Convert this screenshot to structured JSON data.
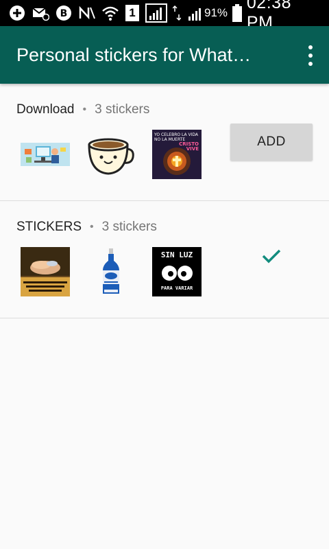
{
  "status_bar": {
    "sim_slot": "1",
    "battery": "91%",
    "time": "02:38 PM"
  },
  "app_bar": {
    "title": "Personal stickers for What…"
  },
  "packs": [
    {
      "name": "Download",
      "separator": "•",
      "count": "3 stickers",
      "action_label": "ADD",
      "thumb_texts": [
        "YO CELEBRO LA VIDA",
        "NO LA MUERTE",
        "CRISTO",
        "VIVE"
      ]
    },
    {
      "name": "STICKERS",
      "separator": "•",
      "count": "3 stickers",
      "action": "check-icon",
      "thumb_texts": [
        "SIN LUZ",
        "PARA VARIAR"
      ]
    }
  ],
  "colors": {
    "app_bar": "#075e54",
    "accent": "#128c7e",
    "background": "#fafafa"
  }
}
